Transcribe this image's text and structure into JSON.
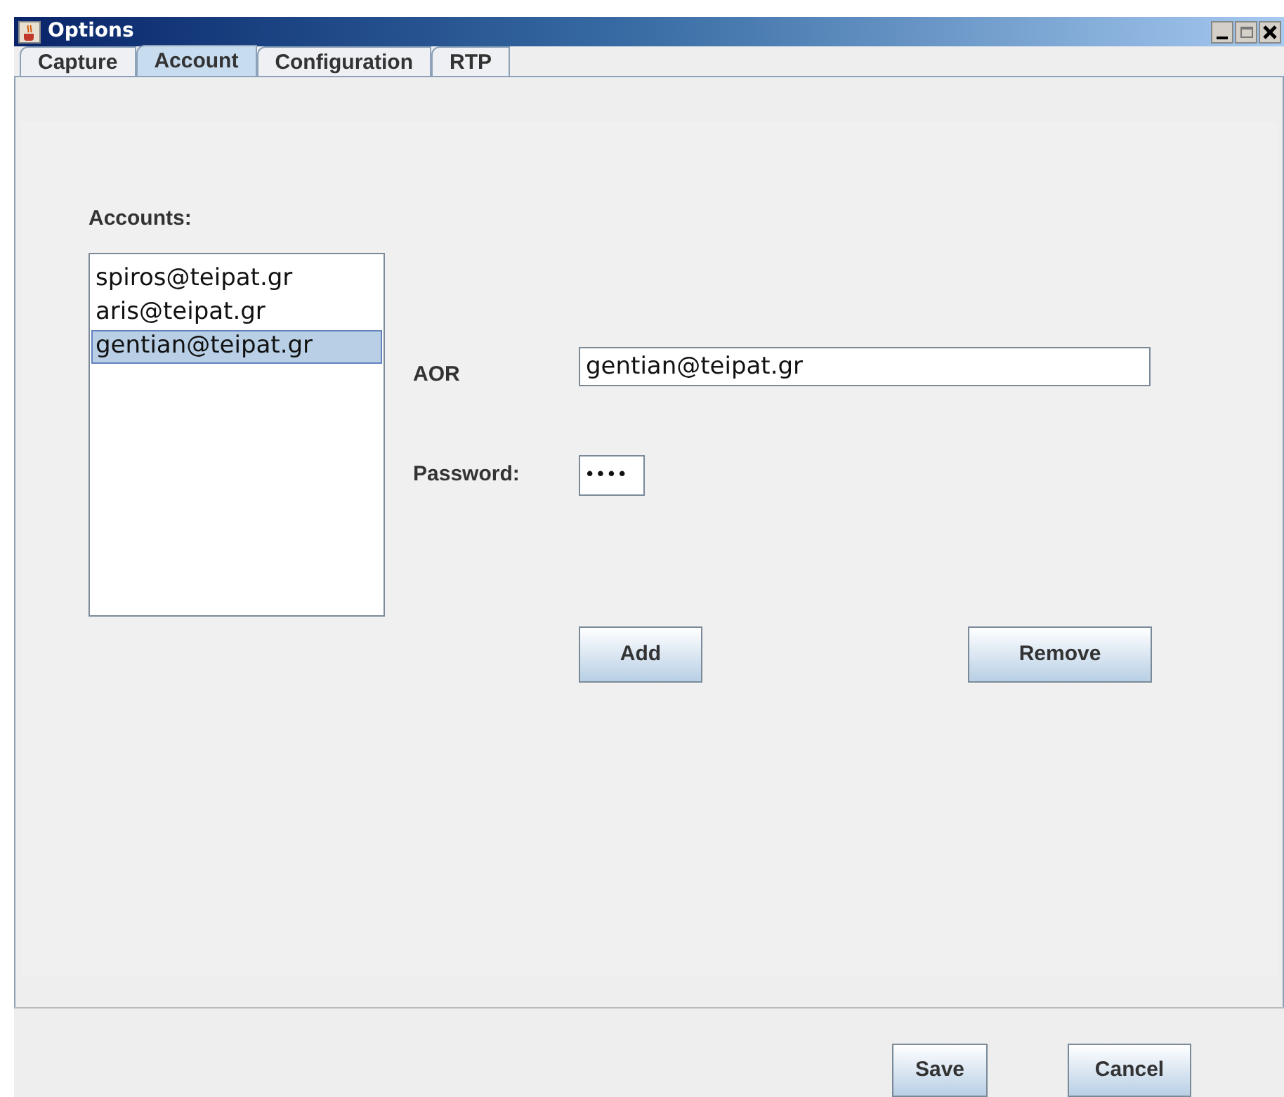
{
  "window": {
    "title": "Options"
  },
  "tabs": [
    {
      "label": "Capture",
      "selected": false
    },
    {
      "label": "Account",
      "selected": true
    },
    {
      "label": "Configuration",
      "selected": false
    },
    {
      "label": "RTP",
      "selected": false
    }
  ],
  "accounts": {
    "label": "Accounts:",
    "items": [
      {
        "text": "spiros@teipat.gr",
        "selected": false
      },
      {
        "text": "aris@teipat.gr",
        "selected": false
      },
      {
        "text": "gentian@teipat.gr",
        "selected": true
      }
    ]
  },
  "aor": {
    "label": "AOR",
    "value": "gentian@teipat.gr"
  },
  "password": {
    "label": "Password:",
    "value": "••••"
  },
  "actions": [
    "Add",
    "Remove"
  ],
  "footer_buttons": [
    "Save",
    "Cancel"
  ]
}
